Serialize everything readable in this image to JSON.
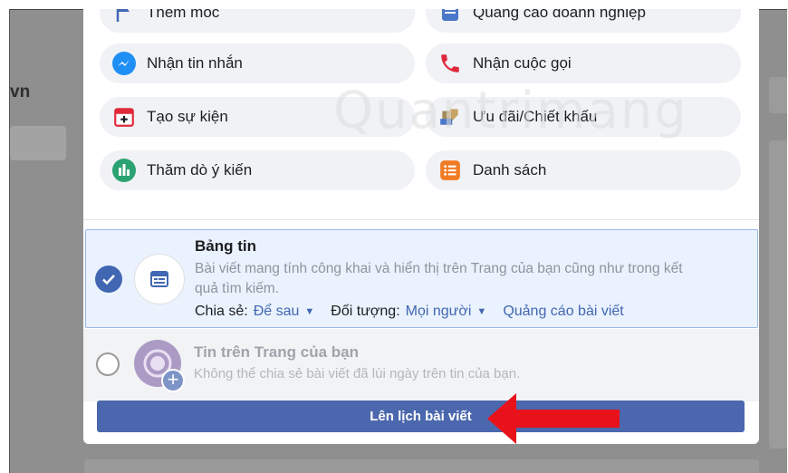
{
  "background": {
    "left_text": "vn"
  },
  "options": [
    {
      "label": "Thêm mốc",
      "icon": "flag-icon"
    },
    {
      "label": "Quảng cáo doanh nghiệp",
      "icon": "business-ad-icon"
    },
    {
      "label": "Nhận tin nhắn",
      "icon": "messenger-icon"
    },
    {
      "label": "Nhận cuộc gọi",
      "icon": "phone-icon"
    },
    {
      "label": "Tạo sự kiện",
      "icon": "calendar-plus-icon"
    },
    {
      "label": "Ưu đãi/Chiết khấu",
      "icon": "offer-tag-icon"
    },
    {
      "label": "Thăm dò ý kiến",
      "icon": "poll-icon"
    },
    {
      "label": "Danh sách",
      "icon": "list-icon"
    }
  ],
  "feed": {
    "title": "Bảng tin",
    "description_line1": "Bài viết mang tính công khai và hiển thị trên Trang của bạn cũng như trong kết",
    "description_line2": "quả tìm kiếm.",
    "share_label": "Chia sẻ:",
    "share_value": "Để sau",
    "audience_label": "Đối tượng:",
    "audience_value": "Mọi người",
    "boost_link": "Quảng cáo bài viết",
    "selected": true
  },
  "page_story": {
    "title": "Tin trên Trang của bạn",
    "description": "Không thể chia sẻ bài viết đã lùi ngày trên tin của bạn.",
    "selected": false
  },
  "schedule_button": "Lên lịch bài viết",
  "watermark": "Quantrimang",
  "colors": {
    "accent": "#4267b2",
    "button": "#4b67ad",
    "arrow": "#e8121b"
  }
}
